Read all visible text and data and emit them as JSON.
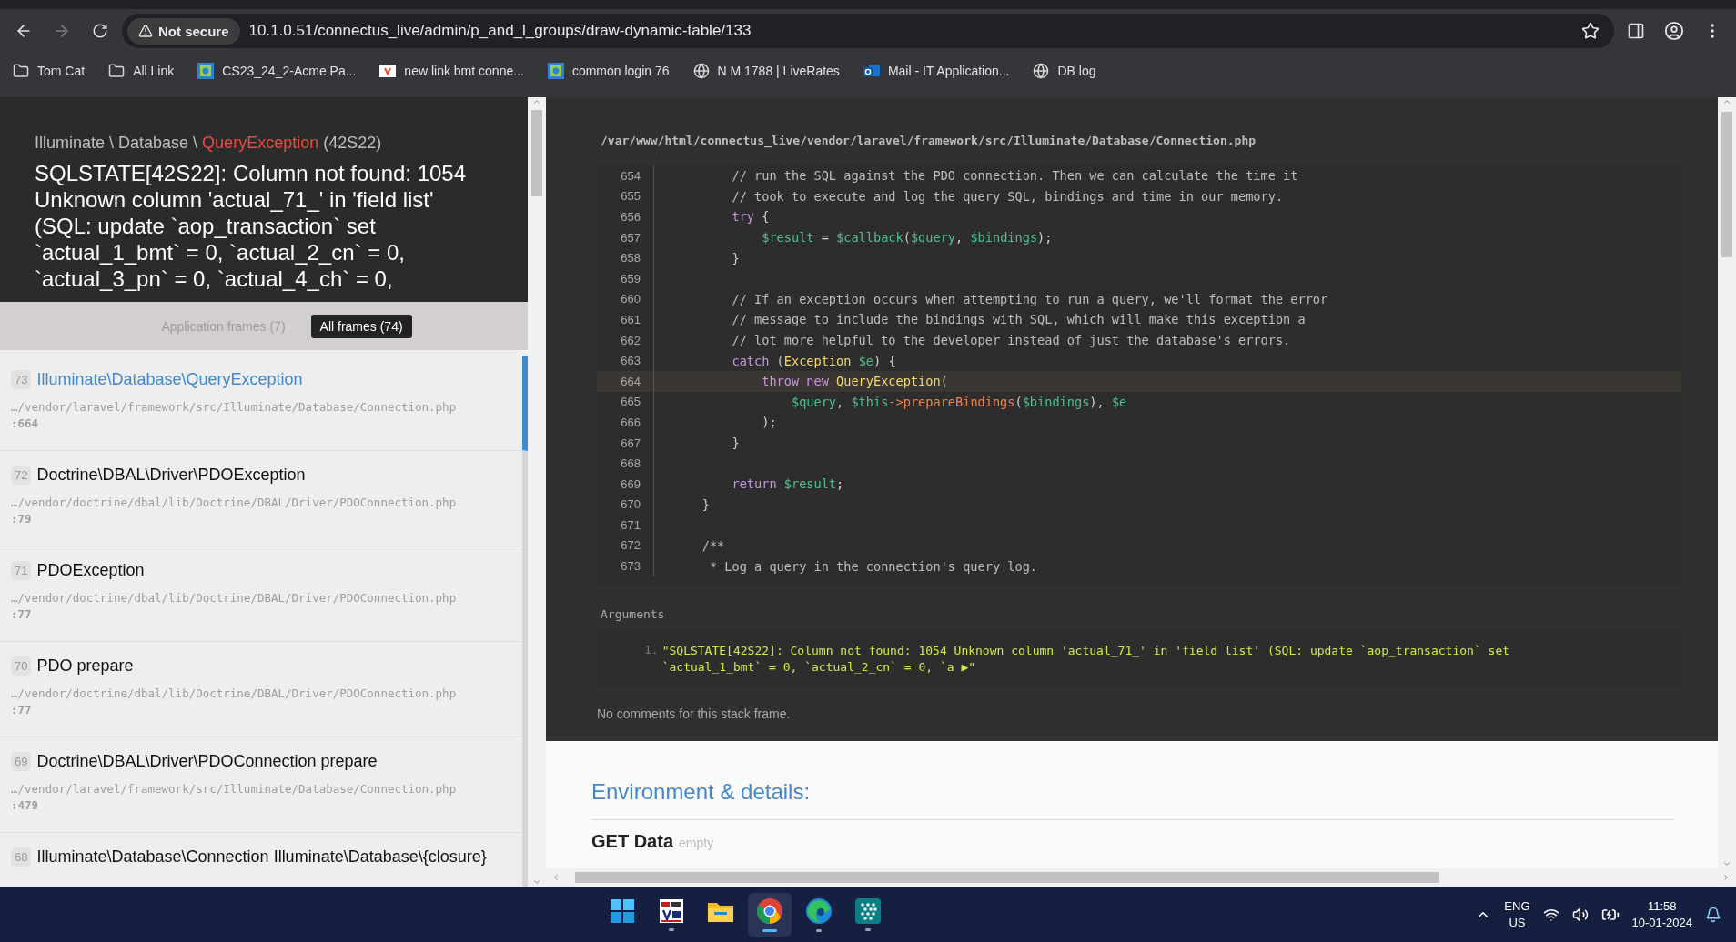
{
  "browser": {
    "nav": [
      {
        "kind": "back",
        "disabled": false
      },
      {
        "kind": "forward",
        "disabled": true
      },
      {
        "kind": "reload",
        "disabled": false
      }
    ],
    "security": "Not secure",
    "url": "10.1.0.51/connectus_live/admin/p_and_l_groups/draw-dynamic-table/133",
    "bookmarks": [
      {
        "label": "Tom Cat",
        "kind": "folder"
      },
      {
        "label": "All Link",
        "kind": "folder"
      },
      {
        "label": "CS23_24_2-Acme Pa...",
        "kind": "app"
      },
      {
        "label": "new link bmt conne...",
        "kind": "site"
      },
      {
        "label": "common login 76",
        "kind": "app"
      },
      {
        "label": "N M 1788 | LiveRates",
        "kind": "globe"
      },
      {
        "label": "Mail - IT Application...",
        "kind": "mail"
      },
      {
        "label": "DB log",
        "kind": "globe"
      }
    ]
  },
  "exception": {
    "namespace": "Illuminate \\ Database \\",
    "class": "QueryException",
    "code": "(42S22)",
    "message": "SQLSTATE[42S22]: Column not found: 1054 Unknown column 'actual_71_' in 'field list' (SQL: update `aop_transaction` set `actual_1_bmt` = 0, `actual_2_cn` = 0, `actual_3_pn` = 0, `actual_4_ch` = 0,"
  },
  "frame_tabs": [
    {
      "label": "Application frames (7)",
      "selected": false
    },
    {
      "label": "All frames (74)",
      "selected": true
    }
  ],
  "frames": [
    {
      "number": "73",
      "name": "Illuminate\\Database\\QueryException",
      "path": "…/vendor/laravel/framework/src/Illuminate/Database/Connection.php",
      "line": ":664",
      "selected": true
    },
    {
      "number": "72",
      "name": "Doctrine\\DBAL\\Driver\\PDOException",
      "path": "…/vendor/doctrine/dbal/lib/Doctrine/DBAL/Driver/PDOConnection.php",
      "line": ":79",
      "selected": false
    },
    {
      "number": "71",
      "name": "PDOException",
      "path": "…/vendor/doctrine/dbal/lib/Doctrine/DBAL/Driver/PDOConnection.php",
      "line": ":77",
      "selected": false
    },
    {
      "number": "70",
      "name": "PDO prepare",
      "path": "…/vendor/doctrine/dbal/lib/Doctrine/DBAL/Driver/PDOConnection.php",
      "line": ":77",
      "selected": false
    },
    {
      "number": "69",
      "name": "Doctrine\\DBAL\\Driver\\PDOConnection prepare",
      "path": "…/vendor/laravel/framework/src/Illuminate/Database/Connection.php",
      "line": ":479",
      "selected": false
    },
    {
      "number": "68",
      "name": "Illuminate\\Database\\Connection Illuminate\\Database\\{closure}",
      "selected": false
    }
  ],
  "code": {
    "file": "/var/www/html/connectus_live/vendor/laravel/framework/src/Illuminate/Database/Connection.php",
    "lines": [
      {
        "number": "654",
        "highlighted": false,
        "tokens": [
          {
            "kind": "comment",
            "text": "        // run the SQL against the PDO connection. Then we can calculate the time it"
          }
        ]
      },
      {
        "number": "655",
        "highlighted": false,
        "tokens": [
          {
            "kind": "comment",
            "text": "        // took to execute and log the query SQL, bindings and time in our memory."
          }
        ]
      },
      {
        "number": "656",
        "highlighted": false,
        "tokens": [
          {
            "kind": "keyword",
            "text": "        try"
          },
          {
            "kind": "plain",
            "text": " {"
          }
        ]
      },
      {
        "number": "657",
        "highlighted": false,
        "tokens": [
          {
            "kind": "variable",
            "text": "            $result"
          },
          {
            "kind": "plain",
            "text": " = "
          },
          {
            "kind": "variable",
            "text": "$callback"
          },
          {
            "kind": "plain",
            "text": "("
          },
          {
            "kind": "variable",
            "text": "$query"
          },
          {
            "kind": "plain",
            "text": ", "
          },
          {
            "kind": "variable",
            "text": "$bindings"
          },
          {
            "kind": "plain",
            "text": ");"
          }
        ]
      },
      {
        "number": "658",
        "highlighted": false,
        "tokens": [
          {
            "kind": "plain",
            "text": "        }"
          }
        ]
      },
      {
        "number": "659",
        "highlighted": false
      },
      {
        "number": "660",
        "highlighted": false,
        "tokens": [
          {
            "kind": "comment",
            "text": "        // If an exception occurs when attempting to run a query, we'll format the error"
          }
        ]
      },
      {
        "number": "661",
        "highlighted": false,
        "tokens": [
          {
            "kind": "comment",
            "text": "        // message to include the bindings with SQL, which will make this exception a"
          }
        ]
      },
      {
        "number": "662",
        "highlighted": false,
        "tokens": [
          {
            "kind": "comment",
            "text": "        // lot more helpful to the developer instead of just the database's errors."
          }
        ]
      },
      {
        "number": "663",
        "highlighted": false,
        "tokens": [
          {
            "kind": "keyword",
            "text": "        catch"
          },
          {
            "kind": "plain",
            "text": " ("
          },
          {
            "kind": "class",
            "text": "Exception"
          },
          {
            "kind": "variable",
            "text": " $e"
          },
          {
            "kind": "plain",
            "text": ") {"
          }
        ]
      },
      {
        "number": "664",
        "highlighted": true,
        "tokens": [
          {
            "kind": "keyword",
            "text": "            throw new"
          },
          {
            "kind": "class",
            "text": " QueryException"
          },
          {
            "kind": "plain",
            "text": "("
          }
        ]
      },
      {
        "number": "665",
        "highlighted": false,
        "tokens": [
          {
            "kind": "variable",
            "text": "                $query"
          },
          {
            "kind": "plain",
            "text": ", "
          },
          {
            "kind": "variable",
            "text": "$this"
          },
          {
            "kind": "method",
            "text": "->prepareBindings"
          },
          {
            "kind": "plain",
            "text": "("
          },
          {
            "kind": "variable",
            "text": "$bindings"
          },
          {
            "kind": "plain",
            "text": "), "
          },
          {
            "kind": "variable",
            "text": "$e"
          }
        ]
      },
      {
        "number": "666",
        "highlighted": false,
        "tokens": [
          {
            "kind": "plain",
            "text": "            );"
          }
        ]
      },
      {
        "number": "667",
        "highlighted": false,
        "tokens": [
          {
            "kind": "plain",
            "text": "        }"
          }
        ]
      },
      {
        "number": "668",
        "highlighted": false
      },
      {
        "number": "669",
        "highlighted": false,
        "tokens": [
          {
            "kind": "keyword",
            "text": "        return"
          },
          {
            "kind": "variable",
            "text": " $result"
          },
          {
            "kind": "plain",
            "text": ";"
          }
        ]
      },
      {
        "number": "670",
        "highlighted": false,
        "tokens": [
          {
            "kind": "plain",
            "text": "    }"
          }
        ]
      },
      {
        "number": "671",
        "highlighted": false
      },
      {
        "number": "672",
        "highlighted": false,
        "tokens": [
          {
            "kind": "comment",
            "text": "    /**"
          }
        ]
      },
      {
        "number": "673",
        "highlighted": false,
        "tokens": [
          {
            "kind": "comment",
            "text": "     * Log a query in the connection's query log."
          }
        ]
      }
    ]
  },
  "arguments": {
    "title": "Arguments",
    "items": [
      {
        "marker": "1.",
        "value": "\"SQLSTATE[42S22]: Column not found: 1054 Unknown column 'actual_71_' in 'field list' (SQL: update `aop_transaction` set `actual_1_bmt` = 0, `actual_2_cn` = 0, `a ▶\""
      }
    ]
  },
  "comments": "No comments for this stack frame.",
  "details": {
    "title": "Environment & details:",
    "section": "GET Data",
    "section_note": "empty"
  },
  "taskbar": {
    "apps": [
      {
        "kind": "start",
        "running": false,
        "active": false
      },
      {
        "kind": "vnc",
        "running": true,
        "active": false
      },
      {
        "kind": "files",
        "running": false,
        "active": false
      },
      {
        "kind": "chrome",
        "running": true,
        "active": true
      },
      {
        "kind": "edge",
        "running": true,
        "active": false
      },
      {
        "kind": "grid",
        "running": true,
        "active": false
      }
    ],
    "language": "ENG",
    "region": "US",
    "time": "11:58",
    "date": "10-01-2024"
  }
}
